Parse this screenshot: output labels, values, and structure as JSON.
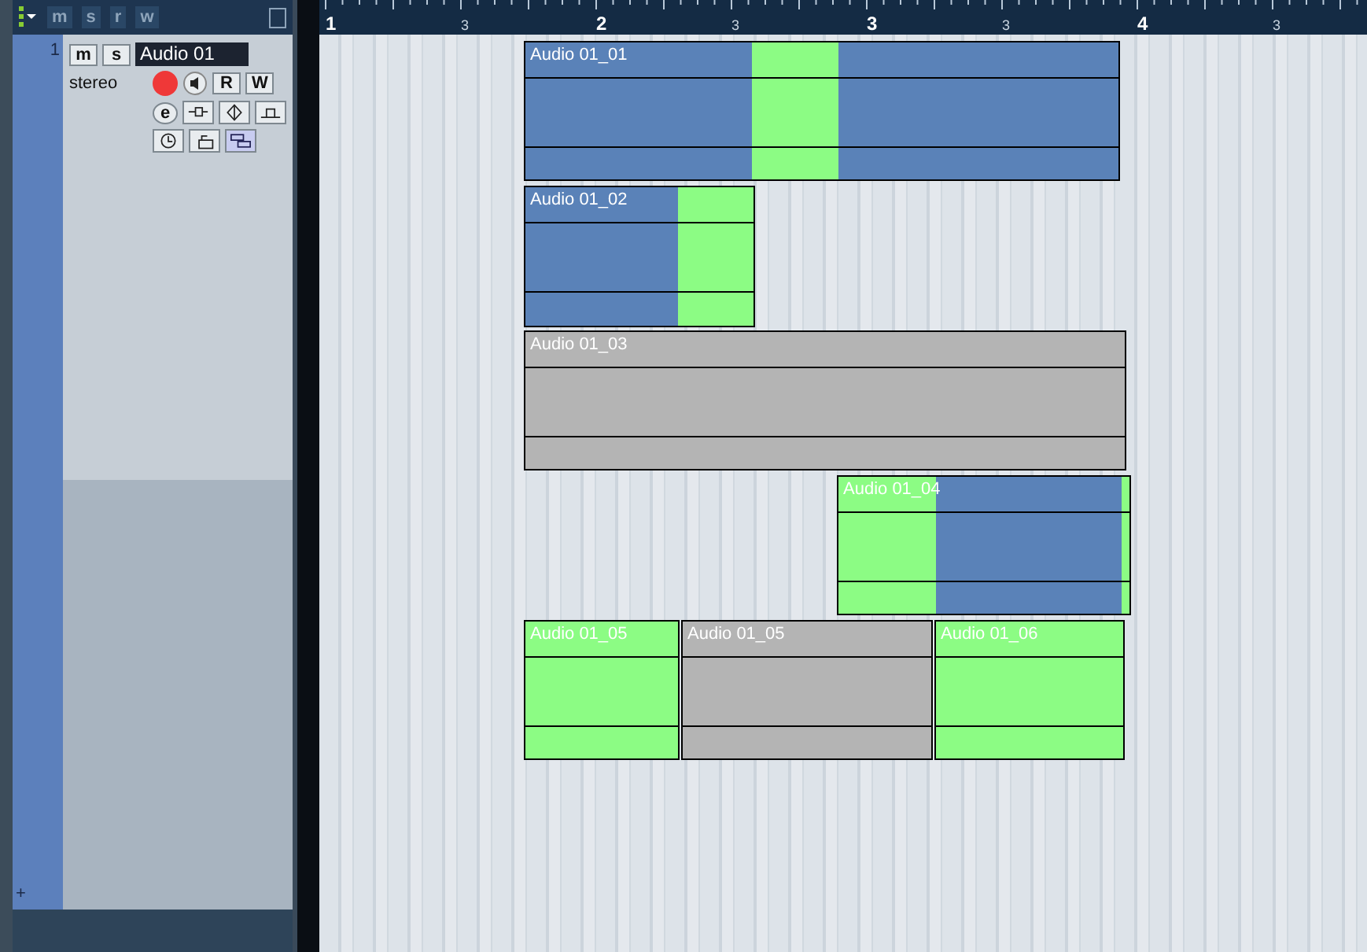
{
  "track_header": {
    "toggles": [
      "m",
      "s",
      "r",
      "w"
    ]
  },
  "track": {
    "number": "1",
    "mute_label": "m",
    "solo_label": "s",
    "name": "Audio 01",
    "channel": "stereo",
    "record_enabled": true,
    "read_label": "R",
    "write_label": "W",
    "edit_label": "e",
    "add_label": "+"
  },
  "ruler": {
    "marks": [
      "1",
      "3",
      "2",
      "3",
      "3",
      "3",
      "4",
      "3"
    ]
  },
  "events": [
    {
      "name": "Audio 01_01",
      "segments": [
        {
          "color": "#5a82b8"
        },
        {
          "color": "#8cfc84"
        },
        {
          "color": "#5a82b8"
        }
      ]
    },
    {
      "name": "Audio 01_02",
      "segments": [
        {
          "color": "#5a82b8"
        },
        {
          "color": "#8cfc84"
        }
      ]
    },
    {
      "name": "Audio 01_03",
      "segments": [
        {
          "color": "#b4b4b4"
        }
      ]
    },
    {
      "name": "Audio 01_04",
      "segments": [
        {
          "color": "#8cfc84"
        },
        {
          "color": "#5a82b8"
        },
        {
          "color": "#8cfc84"
        }
      ]
    },
    {
      "name": "Audio 01_05",
      "segments": [
        {
          "color": "#8cfc84"
        }
      ]
    },
    {
      "name": "Audio 01_05",
      "segments": [
        {
          "color": "#b4b4b4"
        }
      ]
    },
    {
      "name": "Audio 01_06",
      "segments": [
        {
          "color": "#8cfc84"
        }
      ]
    }
  ]
}
